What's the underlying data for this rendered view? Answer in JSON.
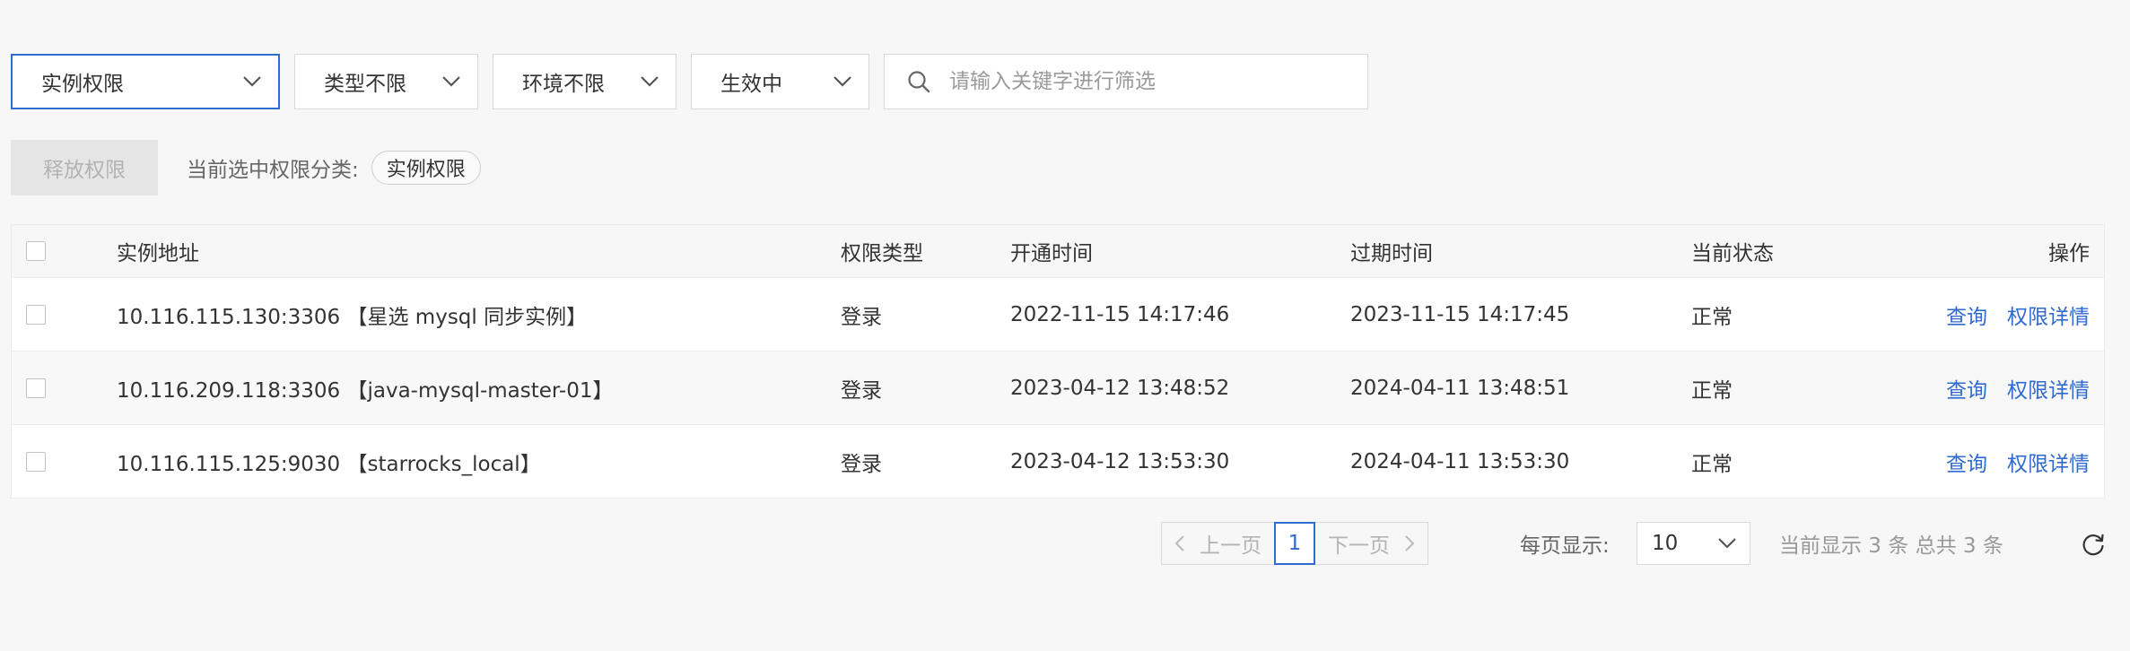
{
  "filters": {
    "category": {
      "label": "实例权限"
    },
    "type": {
      "label": "类型不限"
    },
    "env": {
      "label": "环境不限"
    },
    "status": {
      "label": "生效中"
    },
    "search": {
      "placeholder": "请输入关键字进行筛选",
      "value": ""
    }
  },
  "actions": {
    "release_label": "释放权限",
    "current_label": "当前选中权限分类:",
    "current_tag": "实例权限"
  },
  "table": {
    "headers": {
      "address": "实例地址",
      "type": "权限类型",
      "open_time": "开通时间",
      "expire_time": "过期时间",
      "status": "当前状态",
      "ops": "操作"
    },
    "rows": [
      {
        "address": "10.116.115.130:3306 【星选 mysql 同步实例】",
        "type": "登录",
        "open_time": "2022-11-15 14:17:46",
        "expire_time": "2023-11-15 14:17:45",
        "status": "正常",
        "op_query": "查询",
        "op_detail": "权限详情"
      },
      {
        "address": "10.116.209.118:3306 【java-mysql-master-01】",
        "type": "登录",
        "open_time": "2023-04-12 13:48:52",
        "expire_time": "2024-04-11 13:48:51",
        "status": "正常",
        "op_query": "查询",
        "op_detail": "权限详情"
      },
      {
        "address": "10.116.115.125:9030 【starrocks_local】",
        "type": "登录",
        "open_time": "2023-04-12 13:53:30",
        "expire_time": "2024-04-11 13:53:30",
        "status": "正常",
        "op_query": "查询",
        "op_detail": "权限详情"
      }
    ]
  },
  "pagination": {
    "prev_label": "上一页",
    "next_label": "下一页",
    "current_page": "1",
    "per_page_label": "每页显示:",
    "per_page_value": "10",
    "total_text": "当前显示 3 条 总共 3 条"
  },
  "icons": {
    "search": "search-icon",
    "dropdown": "chevron-down-icon",
    "prev": "chevron-left-icon",
    "next": "chevron-right-icon",
    "refresh": "refresh-icon"
  },
  "colors": {
    "accent": "#2f6bd1",
    "disabled_bg": "#e6e6e6",
    "disabled_text": "#b3b3b3"
  }
}
